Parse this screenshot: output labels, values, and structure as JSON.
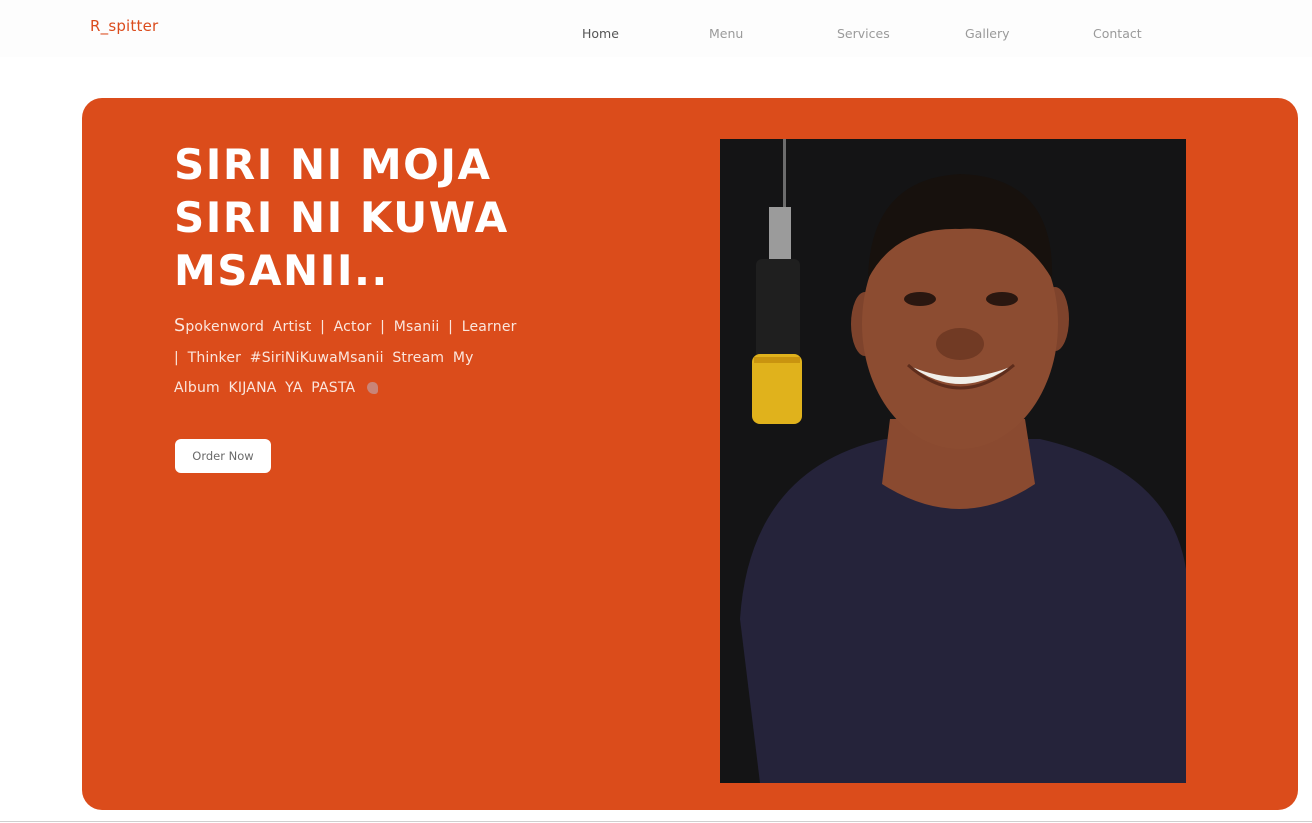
{
  "brand": "R_spitter",
  "nav": {
    "items": [
      {
        "label": "Home",
        "active": true
      },
      {
        "label": "Menu",
        "active": false
      },
      {
        "label": "Services",
        "active": false
      },
      {
        "label": "Gallery",
        "active": false
      },
      {
        "label": "Contact",
        "active": false
      }
    ]
  },
  "hero": {
    "headline": [
      "SIRI NI MOJA",
      "SIRI NI KUWA",
      "MSANII.."
    ],
    "description": {
      "first_letter": "S",
      "text": "pokenword Artist | Actor | Msanii | Learner | Thinker #SiriNiKuwaMsanii Stream My Album KIJANA YA PASTA",
      "trailing_icon": "pointing-down-hand-icon"
    },
    "button_label": "Order Now",
    "photo_icon": "portrait-with-microphone-icon"
  },
  "colors": {
    "accent": "#db4c1b",
    "brand": "#db4c1d",
    "nav_active": "#555555",
    "nav_inactive": "#9a9a9a"
  }
}
